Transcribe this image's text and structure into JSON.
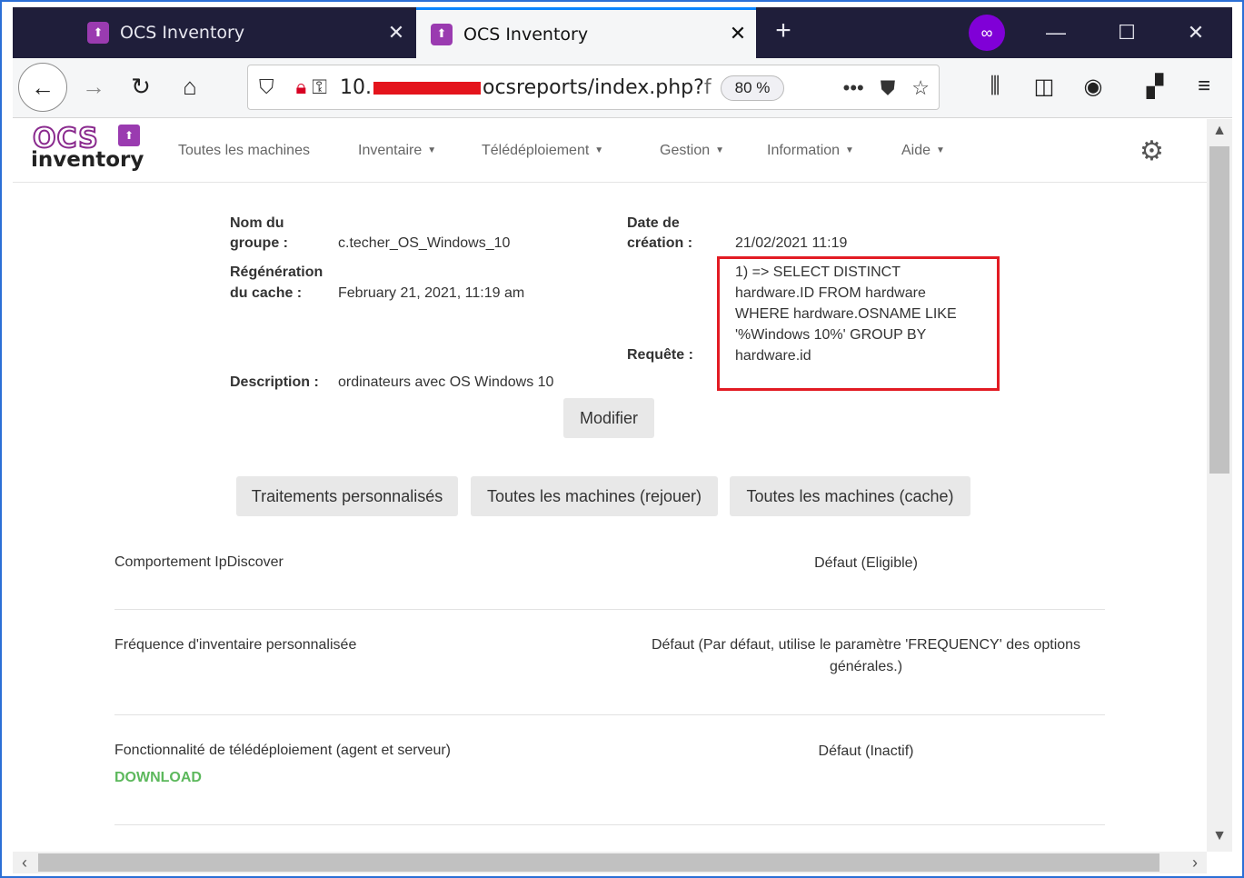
{
  "browser": {
    "tabs": [
      {
        "title": "OCS Inventory",
        "active": false
      },
      {
        "title": "OCS Inventory",
        "active": true
      }
    ],
    "url_prefix": "10.",
    "url_suffix": "ocsreports/index.php?",
    "url_tail": "f",
    "zoom": "80 %"
  },
  "app": {
    "logo_top": "OCS",
    "logo_bottom": "inventory",
    "menu": [
      {
        "label": "Toutes les machines",
        "dropdown": false
      },
      {
        "label": "Inventaire",
        "dropdown": true
      },
      {
        "label": "Télédéploiement",
        "dropdown": true
      },
      {
        "label": "Gestion",
        "dropdown": true
      },
      {
        "label": "Information",
        "dropdown": true
      },
      {
        "label": "Aide",
        "dropdown": true
      }
    ]
  },
  "group": {
    "name_label_1": "Nom du",
    "name_label_2": "groupe :",
    "name_value": "c.techer_OS_Windows_10",
    "date_label_1": "Date de",
    "date_label_2": "création :",
    "date_value": "21/02/2021 11:19",
    "cache_label_1": "Régénération",
    "cache_label_2": "du cache :",
    "cache_value": "February 21, 2021, 11:19 am",
    "request_label": "Requête :",
    "request_lines": [
      "1) => SELECT DISTINCT",
      "hardware.ID FROM hardware",
      "WHERE hardware.OSNAME LIKE",
      "'%Windows 10%' GROUP BY",
      "hardware.id"
    ],
    "description_label": "Description :",
    "description_value": "ordinateurs avec OS Windows 10",
    "modify_button": "Modifier"
  },
  "actions": {
    "custom": "Traitements personnalisés",
    "replay": "Toutes les machines (rejouer)",
    "cache": "Toutes les machines (cache)"
  },
  "settings": [
    {
      "label": "Comportement IpDiscover",
      "value": "Défaut (Eligible)"
    },
    {
      "label": "Fréquence d'inventaire personnalisée",
      "value_1": "Défaut (Par défaut, utilise le paramètre 'FREQUENCY' des options",
      "value_2": "générales.)"
    },
    {
      "label": "Fonctionnalité de télédéploiement (agent et serveur)",
      "value": "Défaut (Inactif)",
      "tag": "DOWNLOAD"
    }
  ],
  "colors": {
    "tabbar": "#1f1e3a",
    "accent": "#0a84ff",
    "highlight_box": "#e21b23",
    "download_tag": "#5cb85c",
    "brand": "#9a3bb0"
  }
}
